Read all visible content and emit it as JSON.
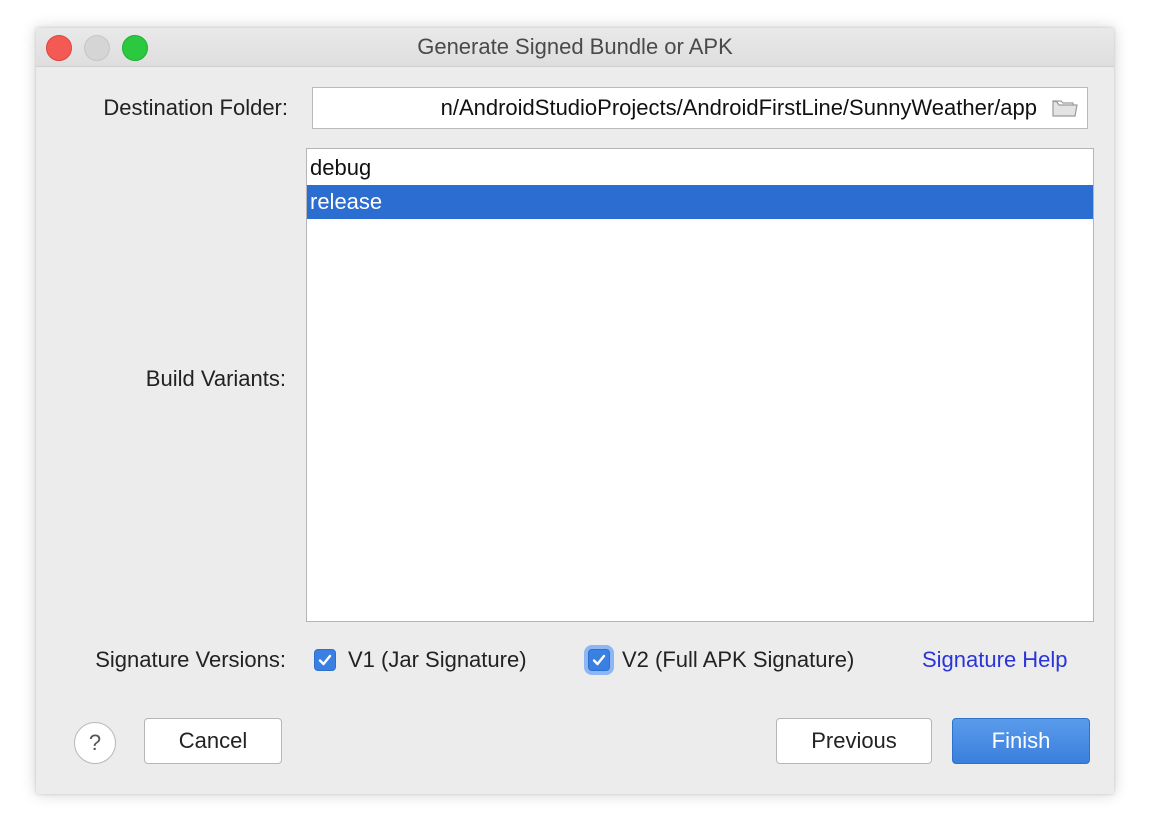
{
  "window": {
    "title": "Generate Signed Bundle or APK"
  },
  "form": {
    "destination_label": "Destination Folder:",
    "destination_value": "n/AndroidStudioProjects/AndroidFirstLine/SunnyWeather/app",
    "build_variants_label": "Build Variants:",
    "build_variants": [
      {
        "label": "debug",
        "selected": false
      },
      {
        "label": "release",
        "selected": true
      }
    ],
    "signature_label": "Signature Versions:",
    "signature_v1": {
      "label": "V1 (Jar Signature)",
      "checked": true
    },
    "signature_v2": {
      "label": "V2 (Full APK Signature)",
      "checked": true
    },
    "signature_help": "Signature Help"
  },
  "buttons": {
    "help": "?",
    "cancel": "Cancel",
    "previous": "Previous",
    "finish": "Finish"
  },
  "colors": {
    "selection": "#2c6dd2",
    "link": "#2a35d8",
    "primary_button": "#3a7fdc"
  }
}
